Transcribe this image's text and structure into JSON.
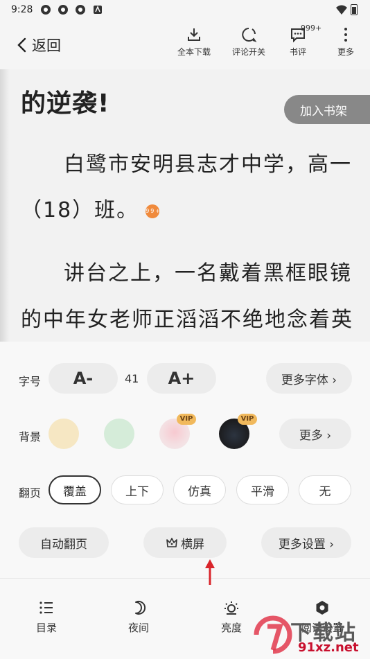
{
  "status_bar": {
    "time": "9:28"
  },
  "top_bar": {
    "back_label": "返回",
    "tools": [
      {
        "label": "全本下载",
        "icon": "download-icon"
      },
      {
        "label": "评论开关",
        "icon": "comment-toggle-icon"
      },
      {
        "label": "书评",
        "icon": "review-icon",
        "badge": "999+"
      },
      {
        "label": "更多",
        "icon": "more-vertical-icon"
      }
    ]
  },
  "reader": {
    "chapter_title": "的逆袭!",
    "add_to_shelf": "加入书架",
    "lines": [
      "白鹭市安明县志才中学，高一",
      "（18）班。",
      "讲台之上，一名戴着黑框眼镜",
      "的中年女老师正滔滔不绝地念着英"
    ],
    "comment_badge": "99+"
  },
  "settings": {
    "font_label": "字号",
    "font_decrease": "A-",
    "font_size": "41",
    "font_increase": "A+",
    "more_fonts": "更多字体 ›",
    "background_label": "背景",
    "backgrounds": [
      {
        "name": "beige",
        "color": "#f6e7c3"
      },
      {
        "name": "green",
        "color": "#d5ecd9"
      },
      {
        "name": "pink-image",
        "color": "#f4dfe2",
        "vip": "VIP"
      },
      {
        "name": "dark-image",
        "color": "#1b1b1d",
        "vip": "VIP"
      }
    ],
    "more_backgrounds": "更多 ›",
    "page_turn_label": "翻页",
    "page_turn_options": [
      "覆盖",
      "上下",
      "仿真",
      "平滑",
      "无"
    ],
    "page_turn_selected": "覆盖",
    "auto_page": "自动翻页",
    "landscape": "横屏",
    "more_settings": "更多设置 ›"
  },
  "bottom_nav": [
    {
      "label": "目录",
      "icon": "list-icon"
    },
    {
      "label": "夜间",
      "icon": "moon-icon"
    },
    {
      "label": "亮度",
      "icon": "brightness-icon"
    },
    {
      "label": "阅读设置",
      "icon": "settings-gear-icon"
    }
  ],
  "watermark": {
    "text": "下载站",
    "url": "91xz.net"
  },
  "colors": {
    "accent_dark": "#333333",
    "vip_gold": "#f1b95c",
    "arrow_red": "#d9252b"
  }
}
